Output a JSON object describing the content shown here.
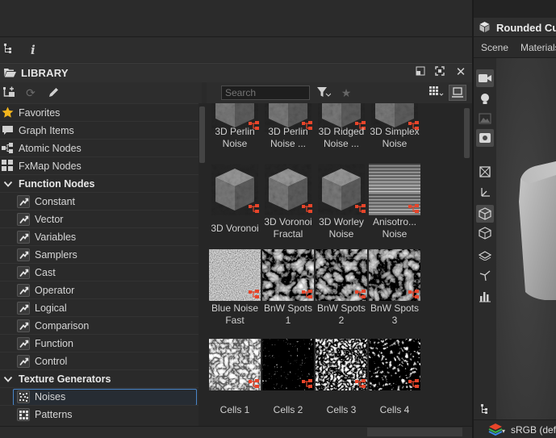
{
  "library": {
    "title": "LIBRARY",
    "search_placeholder": "Search",
    "categories": [
      {
        "label": "Favorites",
        "icon": "star-icon",
        "kind": "top"
      },
      {
        "label": "Graph Items",
        "icon": "comment-icon",
        "kind": "top"
      },
      {
        "label": "Atomic Nodes",
        "icon": "atomic-nodes-icon",
        "kind": "top"
      },
      {
        "label": "FxMap Nodes",
        "icon": "fxmap-icon",
        "kind": "top"
      },
      {
        "label": "Function Nodes",
        "icon": "chevron-down-icon",
        "kind": "cat"
      },
      {
        "label": "Constant",
        "icon": "function-icon",
        "kind": "sub"
      },
      {
        "label": "Vector",
        "icon": "function-icon",
        "kind": "sub"
      },
      {
        "label": "Variables",
        "icon": "function-icon",
        "kind": "sub"
      },
      {
        "label": "Samplers",
        "icon": "function-icon",
        "kind": "sub"
      },
      {
        "label": "Cast",
        "icon": "function-icon",
        "kind": "sub"
      },
      {
        "label": "Operator",
        "icon": "function-icon",
        "kind": "sub"
      },
      {
        "label": "Logical",
        "icon": "function-icon",
        "kind": "sub"
      },
      {
        "label": "Comparison",
        "icon": "function-icon",
        "kind": "sub"
      },
      {
        "label": "Function",
        "icon": "function-icon",
        "kind": "sub"
      },
      {
        "label": "Control",
        "icon": "function-icon",
        "kind": "sub"
      },
      {
        "label": "Texture Generators",
        "icon": "chevron-down-icon",
        "kind": "cat"
      },
      {
        "label": "Noises",
        "icon": "noise-icon",
        "kind": "sub",
        "selected": true
      },
      {
        "label": "Patterns",
        "icon": "pattern-icon",
        "kind": "sub"
      }
    ],
    "items": [
      {
        "line1": "3D Perlin",
        "line2": "Noise",
        "style": "cube"
      },
      {
        "line1": "3D Perlin",
        "line2": "Noise ...",
        "style": "cube"
      },
      {
        "line1": "3D Ridged",
        "line2": "Noise ...",
        "style": "cube"
      },
      {
        "line1": "3D Simplex",
        "line2": "Noise",
        "style": "cube"
      },
      {
        "line1": "3D Voronoi",
        "line2": "",
        "style": "cube"
      },
      {
        "line1": "3D Voronoi",
        "line2": "Fractal",
        "style": "cube"
      },
      {
        "line1": "3D Worley",
        "line2": "Noise",
        "style": "cube"
      },
      {
        "line1": "Anisotro...",
        "line2": "Noise",
        "style": "stripes"
      },
      {
        "line1": "Blue Noise",
        "line2": "Fast",
        "style": "fine"
      },
      {
        "line1": "BnW Spots",
        "line2": "1",
        "style": "cloud"
      },
      {
        "line1": "BnW Spots",
        "line2": "2",
        "style": "cloud"
      },
      {
        "line1": "BnW Spots",
        "line2": "3",
        "style": "cloud"
      },
      {
        "line1": "Cells 1",
        "line2": "",
        "style": "cells-soft"
      },
      {
        "line1": "Cells 2",
        "line2": "",
        "style": "cells-dots"
      },
      {
        "line1": "Cells 3",
        "line2": "",
        "style": "cells-web"
      },
      {
        "line1": "Cells 4",
        "line2": "",
        "style": "cells-hard"
      }
    ]
  },
  "view3d": {
    "title": "Rounded Cube",
    "tabs": [
      "Scene",
      "Materials"
    ],
    "colorspace": "sRGB (default)"
  },
  "colors": {
    "accent": "#4a86c8",
    "badge": "#e8452a",
    "star": "#f2b51d"
  }
}
